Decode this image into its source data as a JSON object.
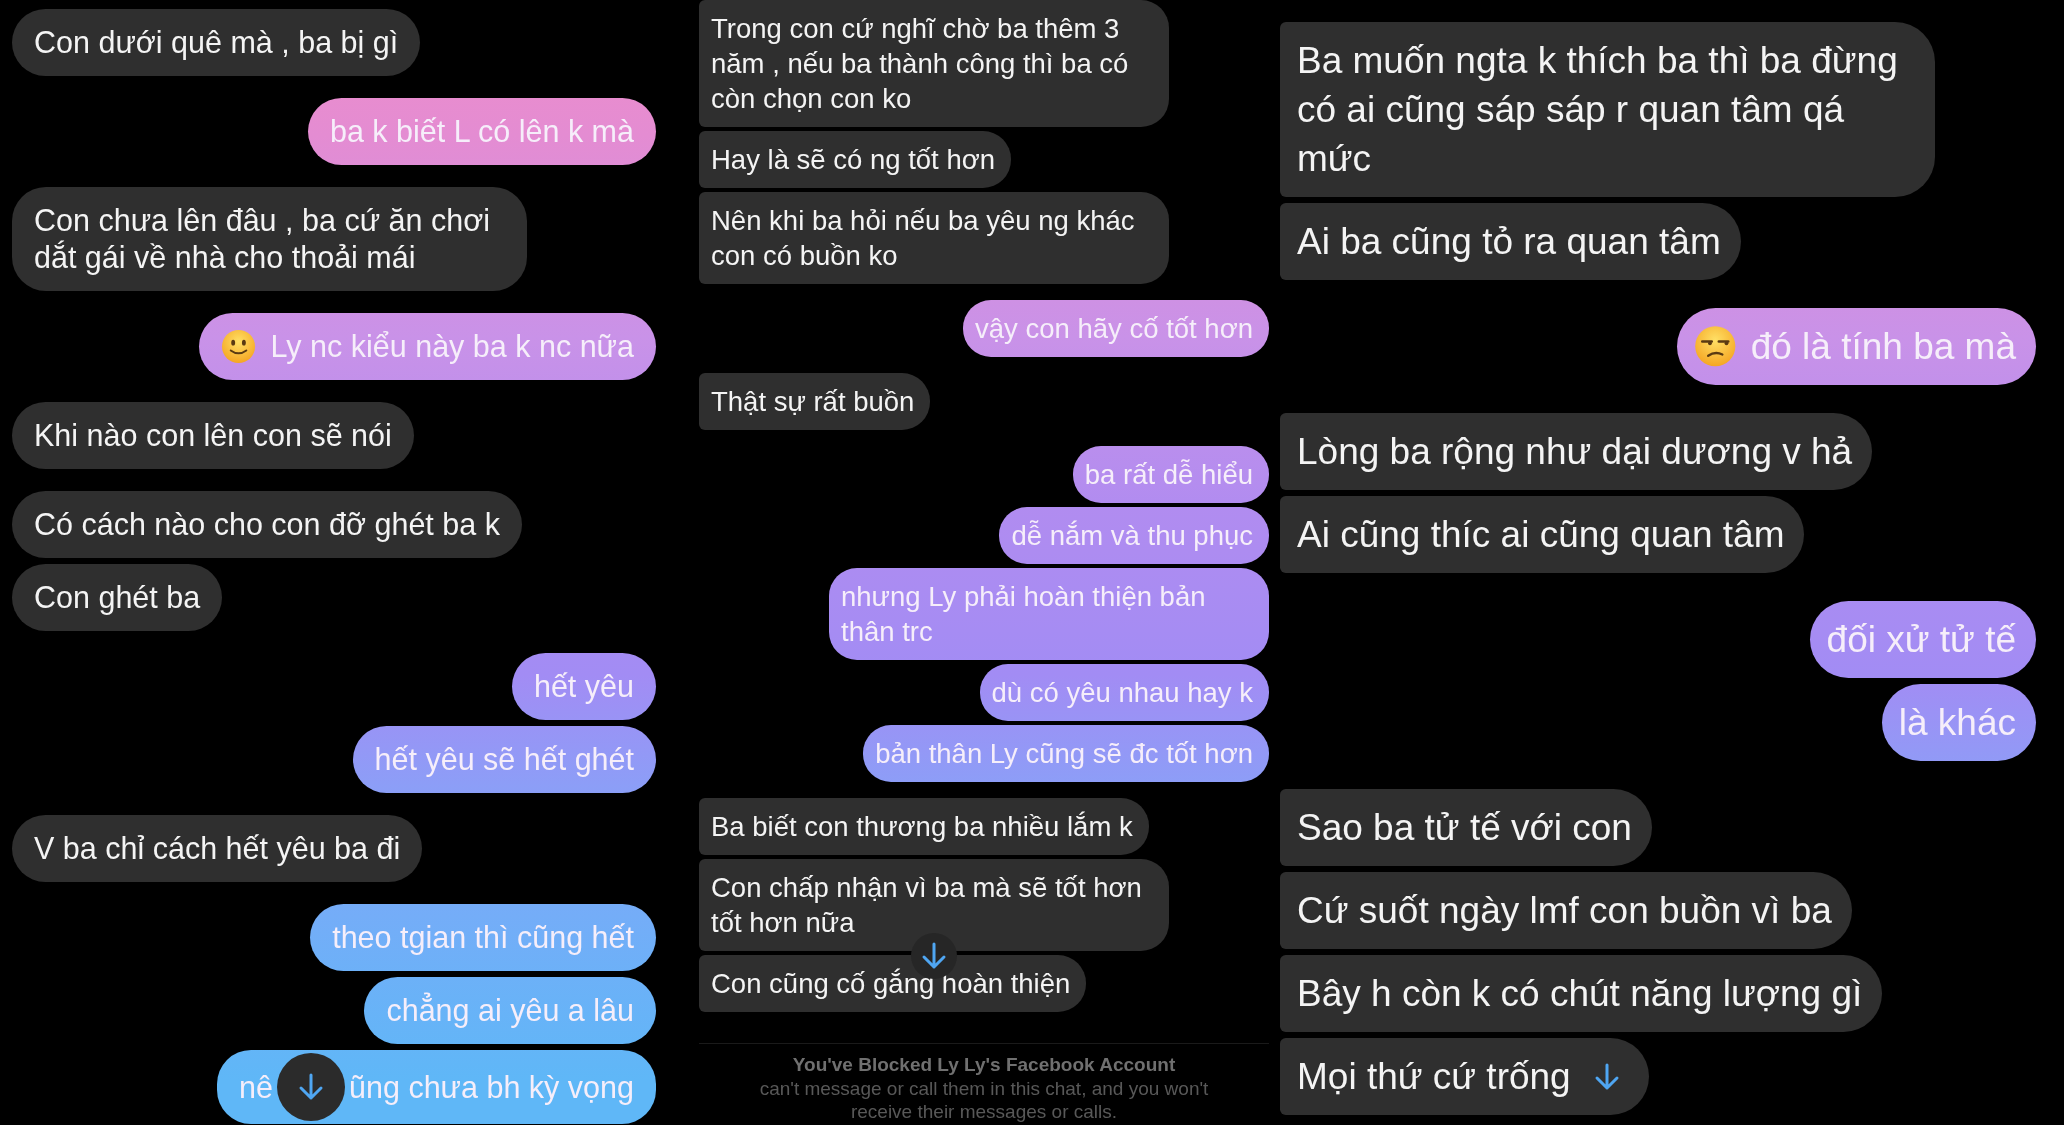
{
  "panels": [
    {
      "groups": [
        {
          "outgoing": false,
          "messages": [
            {
              "kind": "text",
              "text": "Con dưới quê mà , ba bị gì"
            }
          ]
        },
        {
          "outgoing": true,
          "messages": [
            {
              "kind": "text",
              "text": "ba k biết L có lên k mà"
            }
          ]
        },
        {
          "outgoing": false,
          "messages": [
            {
              "kind": "text",
              "text": "Con chưa lên đâu , ba cứ ăn chơi dắt gái về nhà cho thoải mái"
            }
          ]
        },
        {
          "outgoing": true,
          "messages": [
            {
              "kind": "smile_emoji",
              "text": "Ly nc kiểu này ba k nc nữa"
            }
          ]
        },
        {
          "outgoing": false,
          "messages": [
            {
              "kind": "text",
              "text": "Khi nào con lên con sẽ nói"
            }
          ]
        },
        {
          "outgoing": false,
          "messages": [
            {
              "kind": "text",
              "text": "Có cách nào cho con đỡ ghét ba k"
            },
            {
              "kind": "text",
              "text": "Con ghét ba"
            }
          ]
        },
        {
          "outgoing": true,
          "messages": [
            {
              "kind": "text",
              "text": "hết yêu"
            },
            {
              "kind": "text",
              "text": "hết yêu sẽ hết ghét"
            }
          ]
        },
        {
          "outgoing": false,
          "messages": [
            {
              "kind": "text",
              "text": "V ba chỉ cách hết yêu ba đi"
            }
          ]
        },
        {
          "outgoing": true,
          "messages": [
            {
              "kind": "text",
              "text": "theo tgian thì cũng hết"
            },
            {
              "kind": "text",
              "text": "chẳng ai yêu a lâu"
            },
            {
              "kind": "text",
              "text": "nê",
              "scroll_button": {
                "kind": "circle"
              },
              "text_after": "ũng chưa bh kỳ vọng"
            }
          ]
        }
      ]
    },
    {
      "groups": [
        {
          "outgoing": false,
          "messages": [
            {
              "kind": "text",
              "text": "Trong con cứ nghĩ chờ ba thêm 3 năm , nếu ba thành công thì ba có còn chọn con ko"
            },
            {
              "kind": "text",
              "text": "Hay là sẽ có ng tốt hơn"
            },
            {
              "kind": "text",
              "text": "Nên khi ba hỏi nếu ba yêu ng khác con có buồn ko"
            }
          ]
        },
        {
          "outgoing": true,
          "messages": [
            {
              "kind": "text",
              "text": "vậy con hãy cố tốt hơn"
            }
          ]
        },
        {
          "outgoing": false,
          "messages": [
            {
              "kind": "text",
              "text": "Thật sự rất buồn"
            }
          ]
        },
        {
          "outgoing": true,
          "messages": [
            {
              "kind": "text",
              "text": "ba rất dễ hiểu"
            },
            {
              "kind": "text",
              "text": "dễ nắm và thu phục"
            },
            {
              "kind": "text",
              "text": "nhưng Ly phải hoàn thiện bản thân trc"
            },
            {
              "kind": "text",
              "text": "dù có yêu nhau hay k"
            },
            {
              "kind": "text",
              "text": "bản thân Ly cũng sẽ đc tốt hơn"
            }
          ]
        },
        {
          "outgoing": false,
          "messages": [
            {
              "kind": "text",
              "text": "Ba biết con thương ba nhiều lắm k"
            },
            {
              "kind": "text",
              "text": "Con chấp nhận vì ba mà sẽ tốt hơn tốt hơn nữa",
              "scroll_button": {
                "kind": "edge"
              }
            },
            {
              "kind": "text",
              "text": "Con cũng cố gắng hoàn thiện"
            }
          ]
        }
      ],
      "blocked_notice": {
        "title": "You've Blocked Ly Ly's Facebook Account",
        "lines": [
          "can't message or call them in this chat, and you won't",
          "receive their messages or calls."
        ]
      }
    },
    {
      "groups": [
        {
          "outgoing": false,
          "messages": [
            {
              "kind": "text",
              "text": "Ba muốn ngta k thích ba thì ba đừng có ai cũng sáp sáp r quan tâm qá mức"
            },
            {
              "kind": "text",
              "text": "Ai ba cũng tỏ ra quan tâm"
            }
          ]
        },
        {
          "outgoing": true,
          "messages": [
            {
              "kind": "unamused_emoji",
              "text": "đó là tính ba mà"
            }
          ]
        },
        {
          "outgoing": false,
          "messages": [
            {
              "kind": "text",
              "text": "Lòng ba rộng như dại dương v hả"
            },
            {
              "kind": "text",
              "text": "Ai cũng thíc ai cũng quan tâm"
            }
          ]
        },
        {
          "outgoing": true,
          "messages": [
            {
              "kind": "text",
              "text": "đối xử tử tế"
            },
            {
              "kind": "text",
              "text": "là khác"
            }
          ]
        },
        {
          "outgoing": false,
          "messages": [
            {
              "kind": "text",
              "text": "Sao ba tử tế với con"
            },
            {
              "kind": "text",
              "text": "Cứ suốt ngày lmf con buồn vì ba"
            },
            {
              "kind": "text",
              "text": "Bây h còn k có chút năng lượng gì"
            },
            {
              "kind": "text",
              "text": "Mọi thứ cứ trống",
              "scroll_button": {
                "kind": "inline"
              }
            }
          ]
        }
      ]
    }
  ]
}
